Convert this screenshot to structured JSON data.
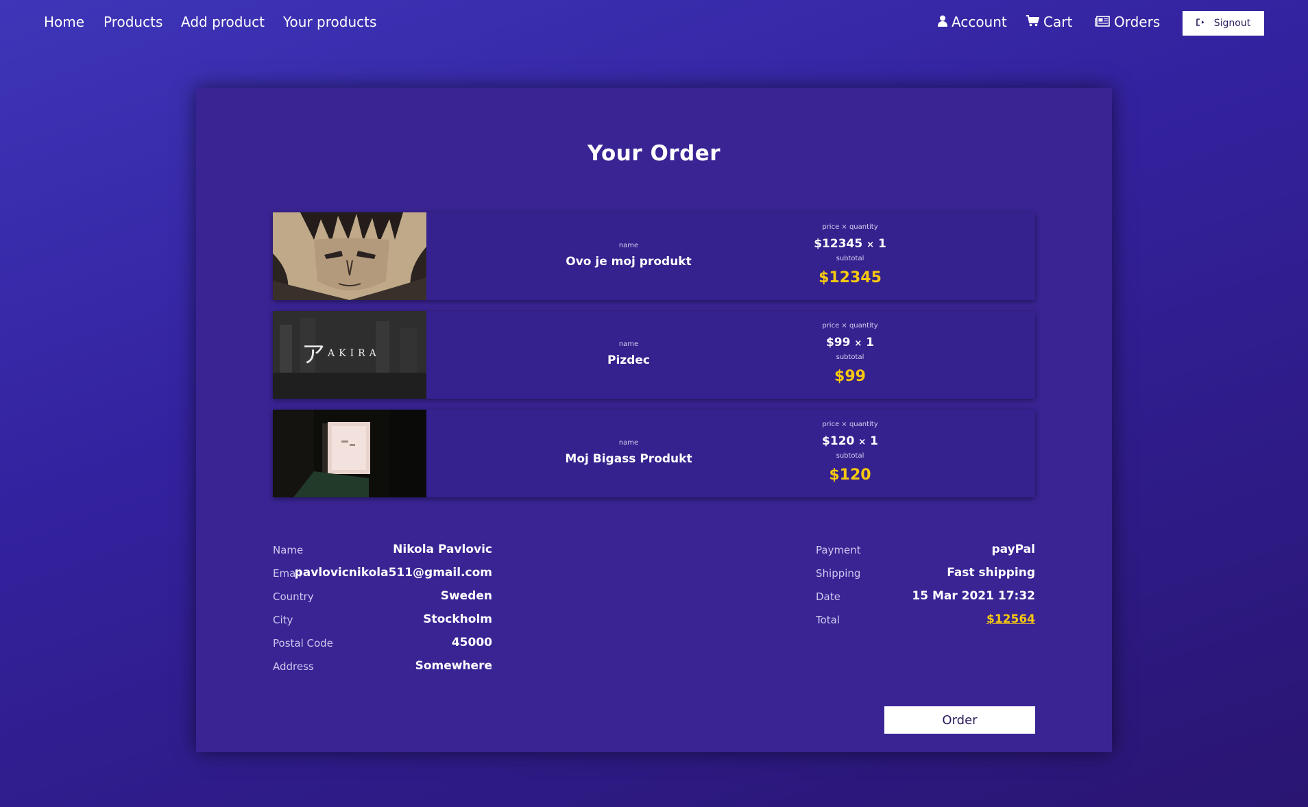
{
  "nav": {
    "left": [
      {
        "label": "Home"
      },
      {
        "label": "Products"
      },
      {
        "label": "Add product"
      },
      {
        "label": "Your products"
      }
    ],
    "account": "Account",
    "cart": "Cart",
    "orders": "Orders",
    "signout": "Signout"
  },
  "order": {
    "title": "Your Order",
    "labels": {
      "name": "name",
      "price_qty": "price × quantity",
      "subtotal": "subtotal",
      "times": "×"
    },
    "items": [
      {
        "name": "Ovo je moj produkt",
        "price": "$12345",
        "qty": "1",
        "subtotal": "$12345",
        "image": "anime-portrait"
      },
      {
        "name": "Pizdec",
        "price": "$99",
        "qty": "1",
        "subtotal": "$99",
        "image": "akira-title"
      },
      {
        "name": "Moj Bigass Produkt",
        "price": "$120",
        "qty": "1",
        "subtotal": "$120",
        "image": "lit-sign"
      }
    ],
    "akira_logo_text": "AKIRA",
    "customer": [
      {
        "label": "Name",
        "value": "Nikola Pavlovic"
      },
      {
        "label": "Email",
        "value": "pavlovicnikola511@gmail.com"
      },
      {
        "label": "Country",
        "value": "Sweden"
      },
      {
        "label": "City",
        "value": "Stockholm"
      },
      {
        "label": "Postal Code",
        "value": "45000"
      },
      {
        "label": "Address",
        "value": "Somewhere"
      }
    ],
    "summary": [
      {
        "label": "Payment",
        "value": "payPal"
      },
      {
        "label": "Shipping",
        "value": "Fast shipping"
      },
      {
        "label": "Date",
        "value": "15 Mar 2021 17:32"
      },
      {
        "label": "Total",
        "value": "$12564"
      }
    ],
    "order_button": "Order"
  },
  "colors": {
    "accent_yellow": "#f6c80f",
    "card": "#3a2494",
    "item": "#35228e"
  }
}
